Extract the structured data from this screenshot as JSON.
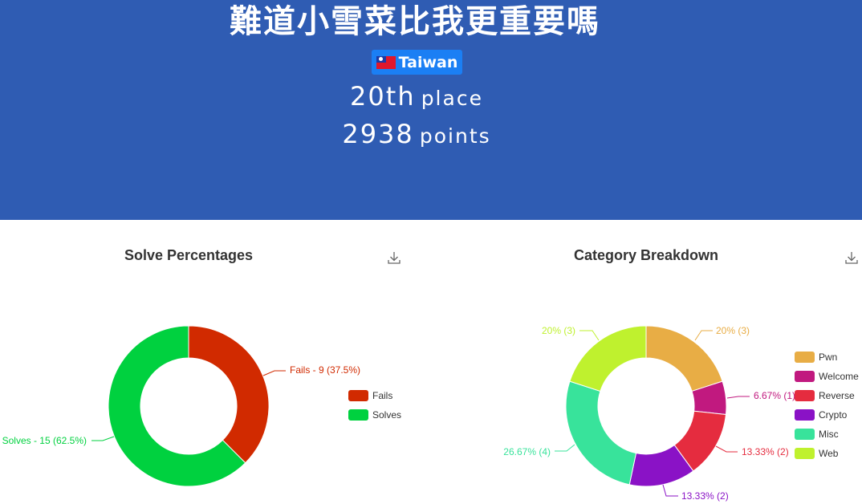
{
  "team": {
    "name": "難道小雪菜比我更重要嗎",
    "country": "Taiwan",
    "rank": "20th",
    "rank_suffix": "place",
    "points": "2938",
    "points_suffix": "points"
  },
  "colors": {
    "header_bg": "#2f5cb3",
    "badge_bg": "#1b7ff4",
    "fails": "#d12a00",
    "solves": "#00d13f"
  },
  "icons": [
    "taiwan-flag-icon",
    "download-icon"
  ],
  "chart_data": [
    {
      "type": "pie",
      "title": "Solve Percentages",
      "legend_position": "right",
      "slices": [
        {
          "name": "Fails",
          "value": 9,
          "label": "Fails - 9 (37.5%)",
          "color": "#d12a00"
        },
        {
          "name": "Solves",
          "value": 15,
          "label": "Solves - 15 (62.5%)",
          "color": "#00d13f"
        }
      ]
    },
    {
      "type": "pie",
      "title": "Category Breakdown",
      "legend_position": "right",
      "slices": [
        {
          "name": "Pwn",
          "value": 3,
          "label": "20% (3)",
          "color": "#e8ad45"
        },
        {
          "name": "Welcome",
          "value": 1,
          "label": "6.67% (1)",
          "color": "#c1197f"
        },
        {
          "name": "Reverse",
          "value": 2,
          "label": "13.33% (2)",
          "color": "#e52c3f"
        },
        {
          "name": "Crypto",
          "value": 2,
          "label": "13.33% (2)",
          "color": "#8a12c6"
        },
        {
          "name": "Misc",
          "value": 4,
          "label": "26.67% (4)",
          "color": "#38e39b"
        },
        {
          "name": "Web",
          "value": 3,
          "label": "20% (3)",
          "color": "#bff12e"
        }
      ]
    }
  ]
}
